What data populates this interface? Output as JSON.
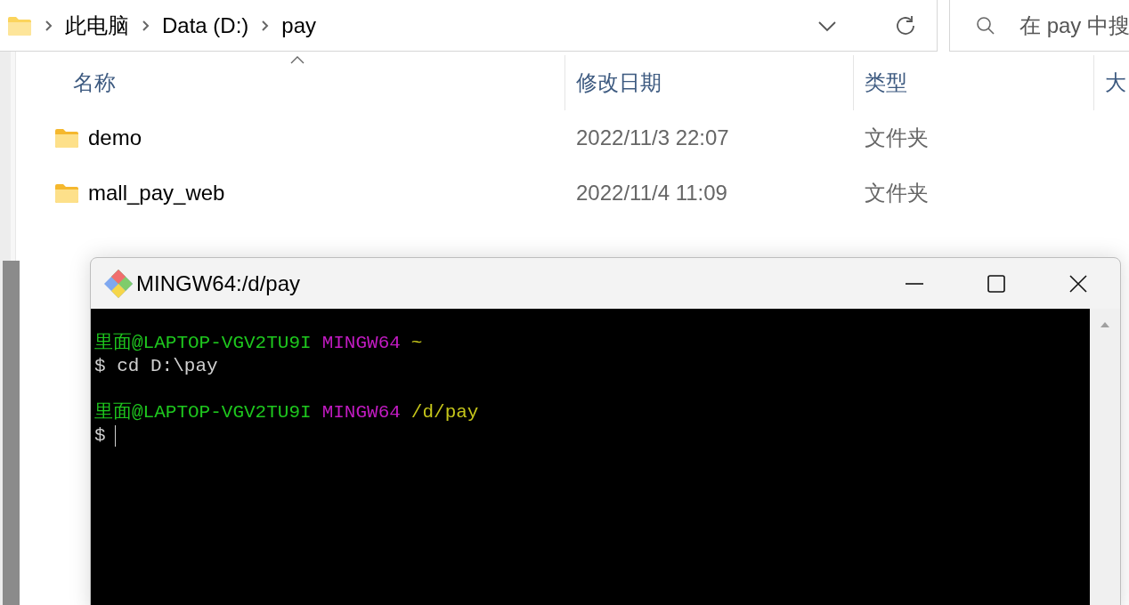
{
  "address_bar": {
    "breadcrumbs": [
      "此电脑",
      "Data (D:)",
      "pay"
    ]
  },
  "search": {
    "placeholder": "在 pay 中搜"
  },
  "table": {
    "columns": [
      {
        "label": "名称",
        "sorted": true
      },
      {
        "label": "修改日期",
        "sorted": false
      },
      {
        "label": "类型",
        "sorted": false
      },
      {
        "label": "大",
        "sorted": false
      }
    ],
    "rows": [
      {
        "name": "demo",
        "modified": "2022/11/3 22:07",
        "type": "文件夹"
      },
      {
        "name": "mall_pay_web",
        "modified": "2022/11/4 11:09",
        "type": "文件夹"
      }
    ]
  },
  "terminal": {
    "title": "MINGW64:/d/pay",
    "blocks": [
      {
        "prompt": [
          {
            "kind": "user",
            "text": "里面@LAPTOP-VGV2TU9I"
          },
          {
            "kind": "system",
            "text": "MINGW64"
          },
          {
            "kind": "path",
            "text": "~"
          }
        ],
        "input": "$ cd D:\\pay"
      },
      {
        "prompt": [
          {
            "kind": "user",
            "text": "里面@LAPTOP-VGV2TU9I"
          },
          {
            "kind": "system",
            "text": "MINGW64"
          },
          {
            "kind": "path",
            "text": "/d/pay"
          }
        ],
        "input": "$"
      }
    ]
  }
}
